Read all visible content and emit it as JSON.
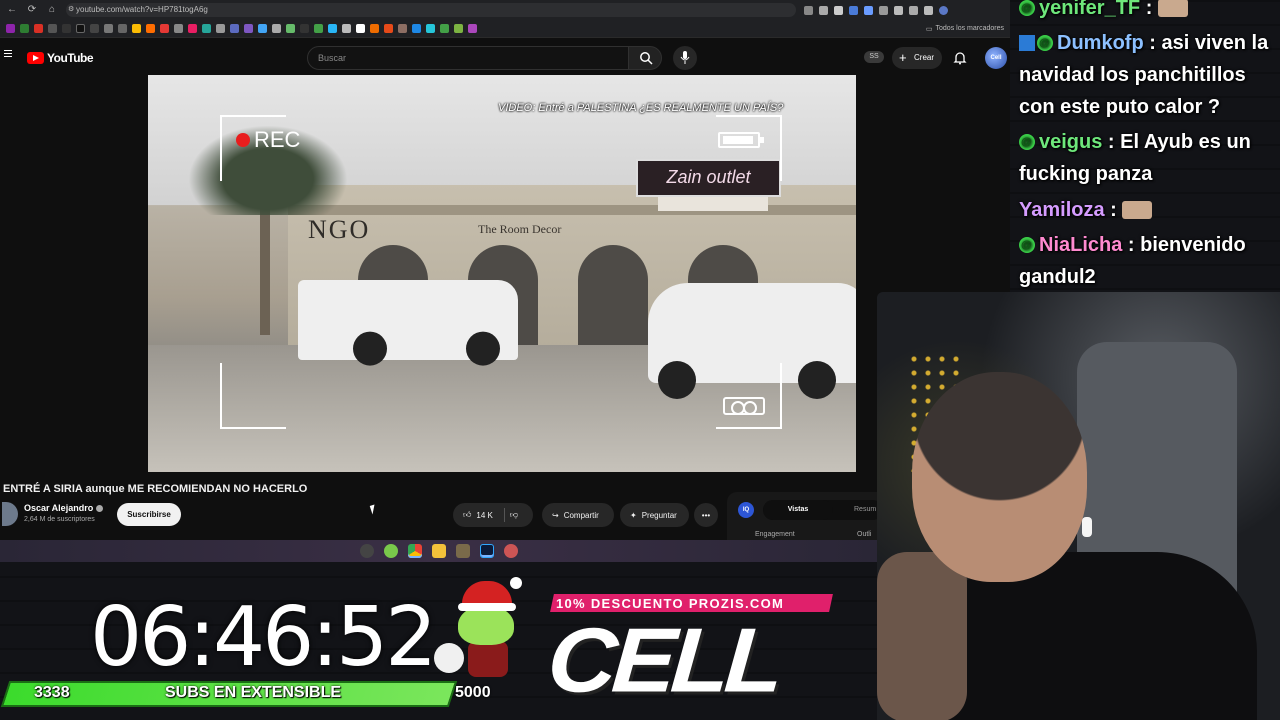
{
  "browser": {
    "url": "youtube.com/watch?v=HP781togA6g",
    "all_bookmarks_label": "Todos los marcadores"
  },
  "youtube": {
    "logo_text": "YouTube",
    "search_placeholder": "Buscar",
    "ss_badge": "SS",
    "create_label": "Crear",
    "avatar_label": "Cell",
    "video": {
      "caption": "VIDEO: Entré a PALESTINA ¿ES REALMENTE UN PAÍS?",
      "rec_label": "REC",
      "shop_name": "NGO",
      "shop_sub": "The Room Decor",
      "sign_text": "Zain outlet"
    },
    "title": "ENTRÉ A SIRIA aunque ME RECOMIENDAN NO HACERLO",
    "channel": {
      "name": "Oscar Alejandro",
      "subs": "2,64 M de suscriptores"
    },
    "subscribe_label": "Suscribirse",
    "likes": "14 K",
    "share_label": "Compartir",
    "ask_label": "Preguntar",
    "more_label": "•••",
    "side_panel": {
      "badge": "IQ",
      "tab_active": "Vistas",
      "tab_other": "Resum",
      "label_left": "Engagement",
      "label_right": "Outli"
    }
  },
  "overlay": {
    "timer": "06:46:52",
    "subs_count": "3338",
    "subs_label": "SUBS EN EXTENSIBLE",
    "subs_goal": "5000",
    "subs_progress": 0.6676,
    "promo": "10% DESCUENTO PROZIS.COM",
    "brand": "CELL"
  },
  "chat": [
    {
      "user": "yenifer_TF",
      "text": "",
      "color": "#6ee77b"
    },
    {
      "user": "Dumkofp",
      "text": "asi viven la navidad los panchitillos con este puto calor ?",
      "color": "#8cc0ff"
    },
    {
      "user": "veigus",
      "text": "El Ayub es un fucking panza",
      "color": "#6ee77b"
    },
    {
      "user": "Yamiloza",
      "text": "",
      "color": "#d59cff"
    },
    {
      "user": "NiaLicha",
      "text": "bienvenido gandul2",
      "color": "#ff8ad0"
    }
  ],
  "colors": {
    "yt_red": "#ff0000",
    "subs_green": "#3bdb2c",
    "promo_pink": "#e0206b",
    "rec_red": "#e81d1d"
  }
}
